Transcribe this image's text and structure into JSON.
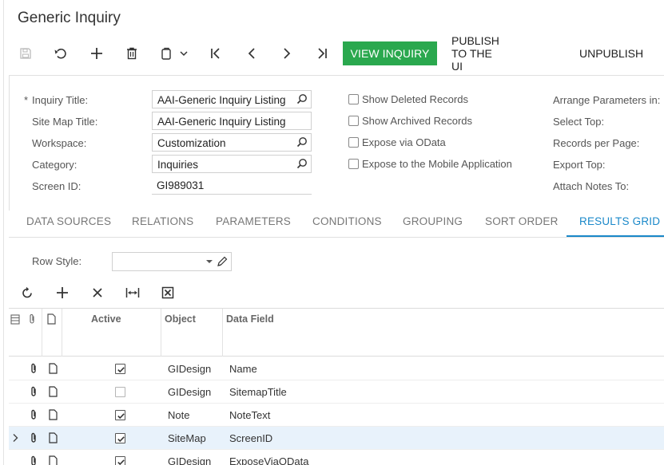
{
  "page": {
    "title": "Generic Inquiry"
  },
  "toolbar": {
    "view_inquiry": "VIEW INQUIRY",
    "publish": "PUBLISH TO THE UI",
    "unpublish": "UNPUBLISH"
  },
  "form": {
    "required_mark": "*",
    "inquiry_title_label": "Inquiry Title:",
    "inquiry_title_value": "AAI-Generic Inquiry Listing",
    "site_map_title_label": "Site Map Title:",
    "site_map_title_value": "AAI-Generic Inquiry Listing",
    "workspace_label": "Workspace:",
    "workspace_value": "Customization",
    "category_label": "Category:",
    "category_value": "Inquiries",
    "screen_id_label": "Screen ID:",
    "screen_id_value": "GI989031",
    "checkboxes": [
      {
        "label": "Show Deleted Records",
        "checked": false
      },
      {
        "label": "Show Archived Records",
        "checked": false
      },
      {
        "label": "Expose via OData",
        "checked": false
      },
      {
        "label": "Expose to the Mobile Application",
        "checked": false
      }
    ],
    "right_labels": [
      "Arrange Parameters in:",
      "Select Top:",
      "Records per Page:",
      "Export Top:",
      "Attach Notes To:"
    ]
  },
  "tabs": [
    {
      "label": "DATA SOURCES",
      "active": false
    },
    {
      "label": "RELATIONS",
      "active": false
    },
    {
      "label": "PARAMETERS",
      "active": false
    },
    {
      "label": "CONDITIONS",
      "active": false
    },
    {
      "label": "GROUPING",
      "active": false
    },
    {
      "label": "SORT ORDER",
      "active": false
    },
    {
      "label": "RESULTS GRID",
      "active": true
    }
  ],
  "results": {
    "row_style_label": "Row Style:",
    "row_style_value": "",
    "columns": {
      "active": "Active",
      "object": "Object",
      "data_field": "Data Field"
    },
    "rows": [
      {
        "active": true,
        "object": "GIDesign",
        "data_field": "Name",
        "selected": false
      },
      {
        "active": false,
        "object": "GIDesign",
        "data_field": "SitemapTitle",
        "selected": false
      },
      {
        "active": true,
        "object": "Note",
        "data_field": "NoteText",
        "selected": false
      },
      {
        "active": true,
        "object": "SiteMap",
        "data_field": "ScreenID",
        "selected": true
      },
      {
        "active": true,
        "object": "GIDesign",
        "data_field": "ExposeViaOData",
        "selected": false
      }
    ]
  },
  "colors": {
    "accent": "#1a88c9",
    "primary_button": "#2aa84e"
  }
}
